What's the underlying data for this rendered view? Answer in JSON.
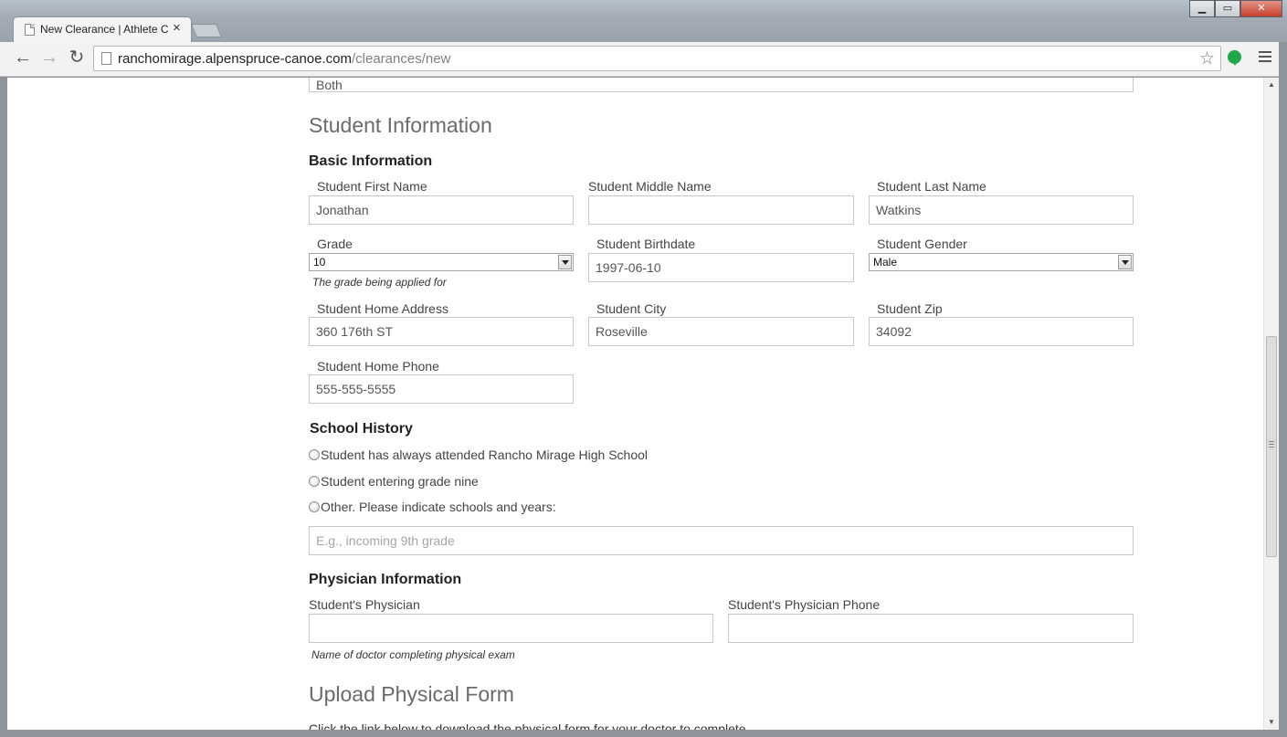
{
  "browser": {
    "tab_title": "New Clearance | Athlete C",
    "url_host": "ranchomirage.alpenspruce-canoe.com",
    "url_path": "/clearances/new"
  },
  "form": {
    "top_field_value": "Both",
    "student_info_title": "Student Information",
    "basic_info_title": "Basic Information",
    "first_name": {
      "label": "Student First Name",
      "value": "Jonathan"
    },
    "middle_name": {
      "label": "Student Middle Name",
      "value": ""
    },
    "last_name": {
      "label": "Student Last Name",
      "value": "Watkins"
    },
    "grade": {
      "label": "Grade",
      "value": "10",
      "help": "The grade being applied for"
    },
    "birthdate": {
      "label": "Student Birthdate",
      "value": "1997-06-10"
    },
    "gender": {
      "label": "Student Gender",
      "value": "Male"
    },
    "address": {
      "label": "Student Home Address",
      "value": "360 176th ST"
    },
    "city": {
      "label": "Student City",
      "value": "Roseville"
    },
    "zip": {
      "label": "Student Zip",
      "value": "34092"
    },
    "phone": {
      "label": "Student Home Phone",
      "value": "555-555-5555"
    },
    "school_history": {
      "title": "School History",
      "options": [
        "Student has always attended Rancho Mirage High School",
        "Student entering grade nine",
        "Other. Please indicate schools and years:"
      ],
      "other_placeholder": "E.g., incoming 9th grade"
    },
    "physician": {
      "title": "Physician Information",
      "name_label": "Student's Physician",
      "name_value": "",
      "name_help": "Name of doctor completing physical exam",
      "phone_label": "Student's Physician Phone",
      "phone_value": ""
    },
    "upload_title": "Upload Physical Form",
    "upload_text": "Click the link below to download the physical form for your doctor to complete."
  }
}
